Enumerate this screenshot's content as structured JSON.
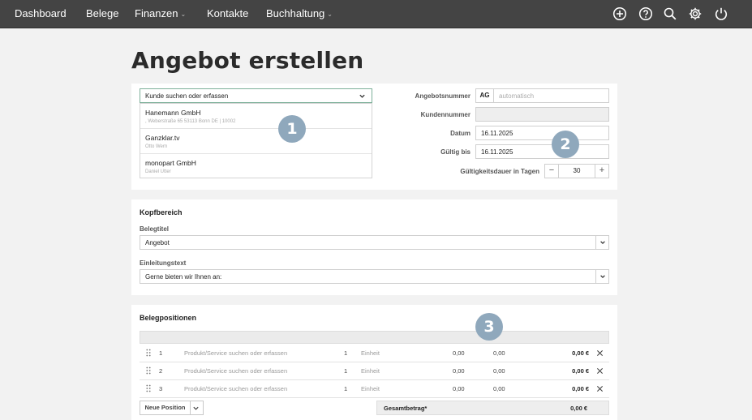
{
  "nav": {
    "items": [
      {
        "label": "Dashboard",
        "has_caret": false
      },
      {
        "label": "Belege",
        "has_caret": false
      },
      {
        "label": "Finanzen",
        "has_caret": true
      },
      {
        "label": "Kontakte",
        "has_caret": false
      },
      {
        "label": "Buchhaltung",
        "has_caret": true
      }
    ],
    "caret": "⌄",
    "icons": [
      "plus-circle-icon",
      "help-circle-icon",
      "search-icon",
      "gear-icon",
      "power-icon"
    ]
  },
  "page": {
    "title": "Angebot erstellen"
  },
  "customer": {
    "search_label": "Kunde suchen oder erfassen",
    "results": [
      {
        "name": "Hanemann GmbH",
        "detail": ", Weberstraße 65 53113 Bonn DE | 10002"
      },
      {
        "name": "Ganzklar.tv",
        "detail": "Otto Wern"
      },
      {
        "name": "monopart GmbH",
        "detail": "Daniel Utter"
      }
    ]
  },
  "offer": {
    "number_label": "Angebotsnummer",
    "number_prefix": "AG",
    "number_placeholder": "automatisch",
    "customer_number_label": "Kundennummer",
    "customer_number_value": "",
    "date_label": "Datum",
    "date_value": "16.11.2025",
    "valid_until_label": "Gültig bis",
    "valid_until_value": "16.11.2025",
    "validity_days_label": "Gültigkeitsdauer in Tagen",
    "validity_days_value": "30",
    "minus": "−",
    "plus": "+"
  },
  "kopfbereich": {
    "heading": "Kopfbereich",
    "belegtitel_label": "Belegtitel",
    "belegtitel_value": "Angebot",
    "einleitung_label": "Einleitungstext",
    "einleitung_value": "Gerne bieten wir Ihnen an:"
  },
  "positions": {
    "heading": "Belegpositionen",
    "rows": [
      {
        "num": "1",
        "product_placeholder": "Produkt/Service suchen oder erfassen",
        "qty": "1",
        "unit": "Einheit",
        "price": "0,00",
        "discount": "0,00",
        "total": "0,00 €"
      },
      {
        "num": "2",
        "product_placeholder": "Produkt/Service suchen oder erfassen",
        "qty": "1",
        "unit": "Einheit",
        "price": "0,00",
        "discount": "0,00",
        "total": "0,00 €"
      },
      {
        "num": "3",
        "product_placeholder": "Produkt/Service suchen oder erfassen",
        "qty": "1",
        "unit": "Einheit",
        "price": "0,00",
        "discount": "0,00",
        "total": "0,00 €"
      }
    ],
    "new_position_label": "Neue Position",
    "total_label": "Gesamtbetrag*",
    "total_value": "0,00 €"
  },
  "badges": [
    "1",
    "2",
    "3"
  ],
  "colors": {
    "nav_bg": "#444444",
    "badge": "#8fa8bc",
    "focus_border": "#7db09a"
  }
}
